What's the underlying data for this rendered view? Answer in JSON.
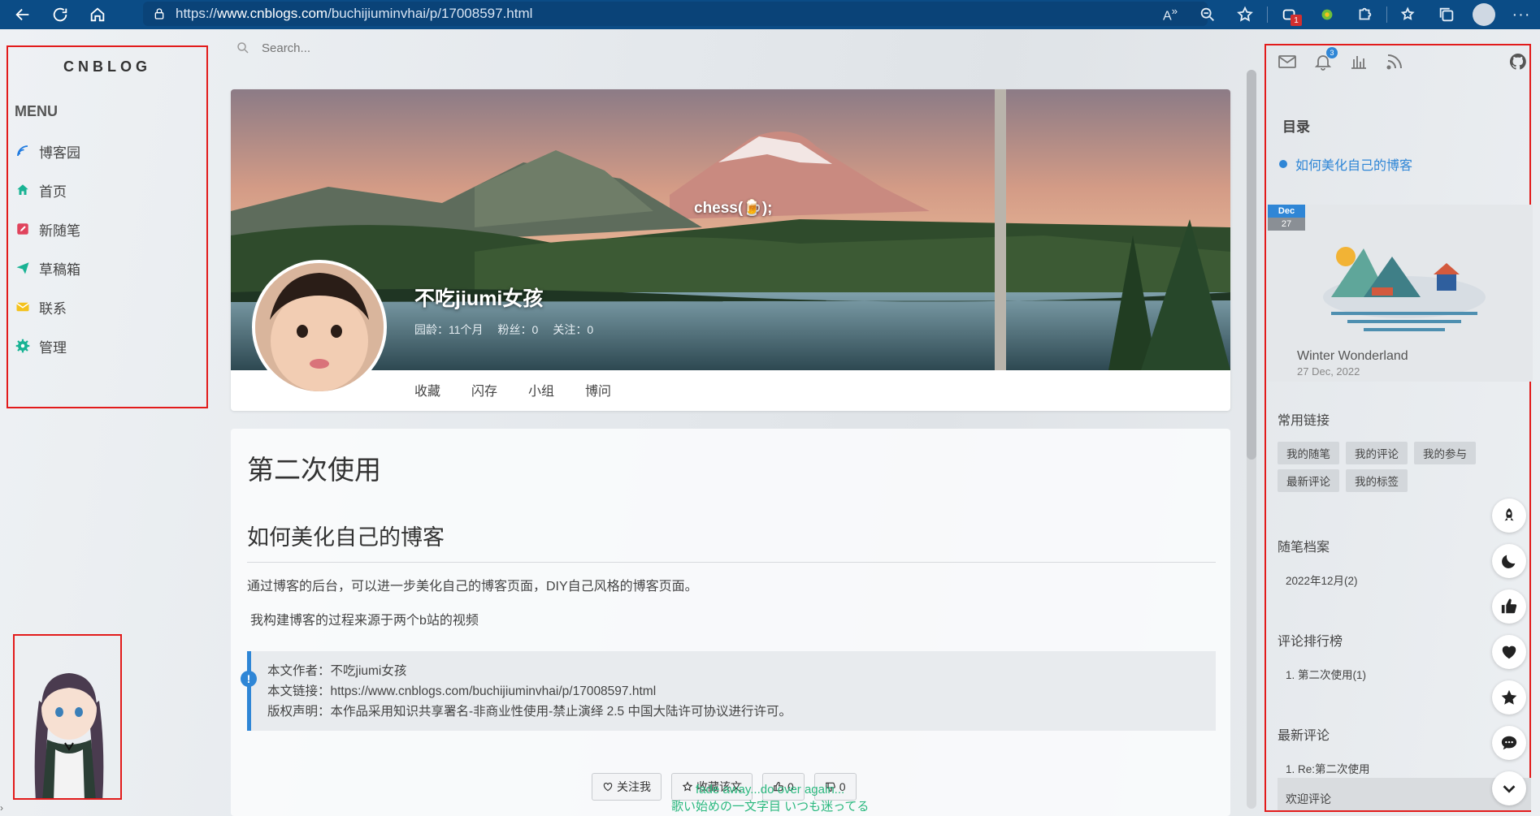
{
  "browser": {
    "url_prefix": "https://",
    "url_host": "www.cnblogs.com",
    "url_path": "/buchijiuminvhai/p/17008597.html",
    "ext_badge": "1"
  },
  "search": {
    "placeholder": "Search..."
  },
  "left_sidebar": {
    "brand": "CNBLOG",
    "menu_title": "MENU",
    "items": [
      {
        "label": "博客园",
        "icon": "cnblogs-icon",
        "color": "#1f7ae0"
      },
      {
        "label": "首页",
        "icon": "home-icon",
        "color": "#19b394"
      },
      {
        "label": "新随笔",
        "icon": "edit-icon",
        "color": "#e0435c"
      },
      {
        "label": "草稿箱",
        "icon": "send-icon",
        "color": "#19b394"
      },
      {
        "label": "联系",
        "icon": "mail-icon",
        "color": "#f4c21d"
      },
      {
        "label": "管理",
        "icon": "gear-icon",
        "color": "#19b394"
      }
    ]
  },
  "hero": {
    "tagline": "chess(🍺);",
    "name": "不吃jiumi女孩",
    "stats": [
      "园龄：11个月",
      "粉丝：0",
      "关注：0"
    ],
    "nav": [
      "收藏",
      "闪存",
      "小组",
      "博问"
    ]
  },
  "post": {
    "title": "第二次使用",
    "heading": "如何美化自己的博客",
    "p1": "通过博客的后台，可以进一步美化自己的博客页面，DIY自己风格的博客页面。",
    "p2": "我构建博客的过程来源于两个b站的视频",
    "copyright": {
      "icon": "!",
      "author": "本文作者：不吃jiumi女孩",
      "link": "本文链接：https://www.cnblogs.com/buchijiuminvhai/p/17008597.html",
      "license": "版权声明：本作品采用知识共享署名-非商业性使用-禁止演绎 2.5 中国大陆许可协议进行许可。"
    },
    "actions": {
      "follow": "关注我",
      "collect": "收藏该文",
      "like": "0",
      "dislike": "0"
    },
    "lyric_line1": "fade away...do over again...",
    "lyric_line2": "歌い始めの一文字目 いつも迷ってる"
  },
  "right_sidebar": {
    "notify_count": "3",
    "toc_title": "目录",
    "toc_items": [
      "如何美化自己的博客"
    ],
    "feature": {
      "month": "Dec",
      "day": "27",
      "title": "Winter Wonderland",
      "date": "27 Dec, 2022"
    },
    "links_title": "常用链接",
    "links_row1": [
      "我的随笔",
      "我的评论",
      "我的参与"
    ],
    "links_row2": [
      "最新评论",
      "我的标签"
    ],
    "archive_title": "随笔档案",
    "archive_items": [
      "2022年12月(2)"
    ],
    "rank_title": "评论排行榜",
    "rank_items": [
      "1. 第二次使用(1)"
    ],
    "latest_title": "最新评论",
    "latest_items": [
      "1. Re:第二次使用"
    ],
    "welcome": "欢迎评论"
  },
  "colors": {
    "browser_bar": "#0b4c86",
    "accent": "#2f86d6",
    "highlight_border": "#e21b1b",
    "lyric": "#2ab87e"
  }
}
